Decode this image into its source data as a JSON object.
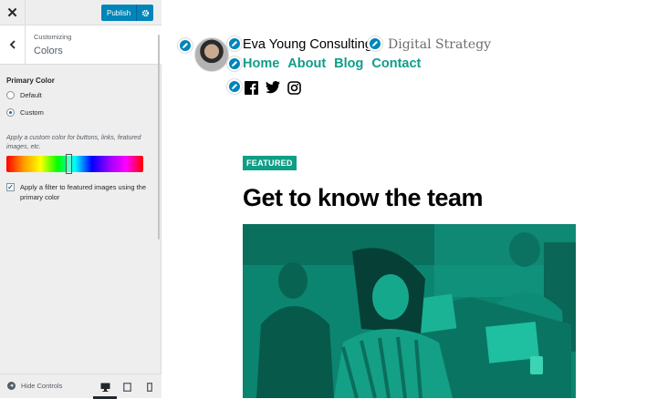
{
  "sidebar": {
    "publish_label": "Publish",
    "customizing_label": "Customizing",
    "section_title": "Colors",
    "primary_color_title": "Primary Color",
    "options": [
      "Default",
      "Custom"
    ],
    "selected_option": "Custom",
    "description": "Apply a custom color for buttons, links, featured images, etc.",
    "filter_checkbox_label": "Apply a filter to featured images using the primary color",
    "filter_checked": true,
    "hide_controls_label": "Hide Controls",
    "color_slider_position": 0.46
  },
  "preview": {
    "site_title": "Eva Young Consulting",
    "site_description": "Digital Strategy",
    "nav": [
      "Home",
      "About",
      "Blog",
      "Contact"
    ],
    "social_icons": [
      "facebook-icon",
      "twitter-icon",
      "instagram-icon"
    ],
    "badge": "FEATURED",
    "post_title": "Get to know the team"
  },
  "colors": {
    "accent": "#0f9e86",
    "button_blue": "#0085ba"
  }
}
